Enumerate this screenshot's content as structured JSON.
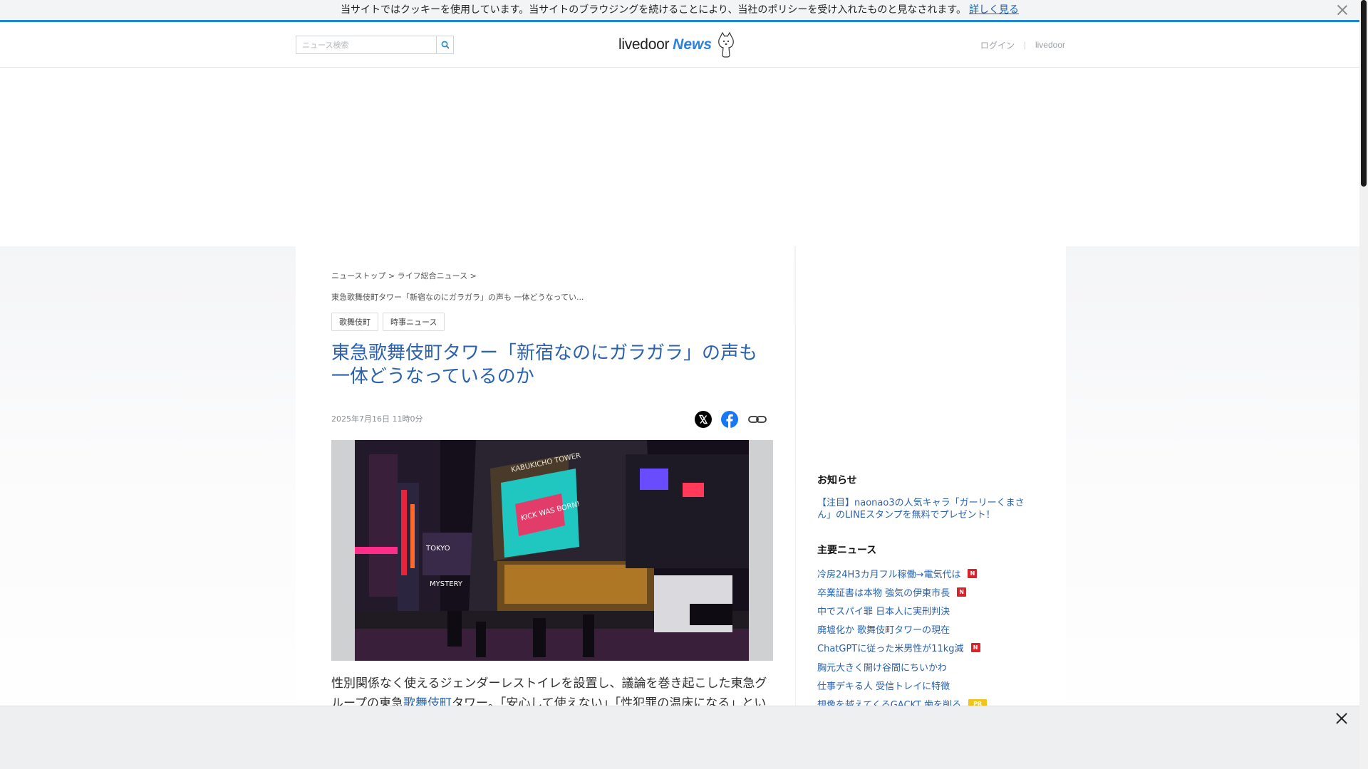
{
  "cookie": {
    "message": "当サイトではクッキーを使用しています。当サイトのブラウジングを続けることにより、当社のポリシーを受け入れたものと見なされます。",
    "link": "詳しく見る"
  },
  "header": {
    "search_placeholder": "ニュース検索",
    "logo_word1": "livedoor",
    "logo_word2": "News",
    "login": "ログイン",
    "separator": "|",
    "livedoor": "livedoor"
  },
  "breadcrumb": {
    "items": [
      "ニューストップ",
      "ライフ総合ニュース"
    ],
    "sep": ">",
    "current": "東急歌舞伎町タワー「新宿なのにガラガラ」の声も 一体どうなってい..."
  },
  "tags": [
    "歌舞伎町",
    "時事ニュース"
  ],
  "article": {
    "headline": "東急歌舞伎町タワー「新宿なのにガラガラ」の声も一体どうなっているのか",
    "date": "2025年7月16日 11時0分",
    "body_part1": "性別関係なく使えるジェンダーレストイレを設置し、議論を巻き起こした東急グループの東急",
    "body_link": "歌舞伎町",
    "body_part2": "タワー。「安心して使えない」「性犯罪の温床になる」という批判が"
  },
  "photo": {
    "tower_sign": "KABUKICHO TOWER",
    "screen_text": "KICK WAS BORN!",
    "building_sign": "TOKYO",
    "sign2": "MYSTERY"
  },
  "sidebar": {
    "notice_title": "お知らせ",
    "notice_link": "【注目】naonao3の人気キャラ「ガーリーくまさん」のLINEスタンプを無料でプレゼント！",
    "news_title": "主要ニュース",
    "news": [
      {
        "text": "冷房24H3カ月フル稼働→電気代は",
        "badge": "N"
      },
      {
        "text": "卒業証書は本物 強気の伊東市長",
        "badge": "N"
      },
      {
        "text": "中でスパイ罪 日本人に実刑判決",
        "badge": ""
      },
      {
        "text": "廃墟化か 歌舞伎町タワーの現在",
        "badge": ""
      },
      {
        "text": "ChatGPTに従った米男性が11kg減",
        "badge": "N"
      },
      {
        "text": "胸元大きく開け谷間にちいかわ",
        "badge": ""
      },
      {
        "text": "仕事デキる人 受信トレイに特徴",
        "badge": ""
      },
      {
        "text": "想像を越えてくるGACKT 歯を削る",
        "badge": "PR"
      }
    ]
  },
  "colors": {
    "accent": "#1e88d8",
    "link": "#2a62ad",
    "new_badge": "#d8232a",
    "pr_badge": "#f0c419"
  }
}
